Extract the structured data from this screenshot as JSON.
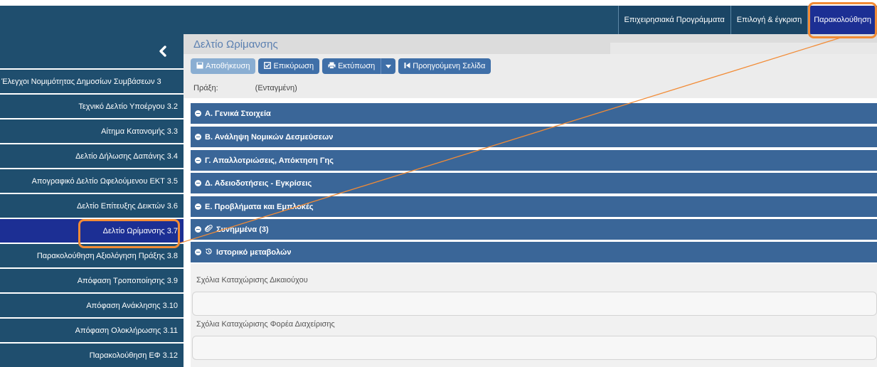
{
  "topnav": {
    "items": [
      {
        "label": "Επιχειρησιακά Προγράμματα"
      },
      {
        "label": "Επιλογή & έγκριση"
      },
      {
        "label": "Παρακολούθηση"
      }
    ]
  },
  "sidebar": {
    "collapse_icon": "chevron-left-icon",
    "items": [
      {
        "label": "Έλεγχοι Νομιμότητας Δημοσίων Συμβάσεων 3"
      },
      {
        "label": "Τεχνικό Δελτίο Υποέργου 3.2"
      },
      {
        "label": "Αίτημα Κατανομής 3.3"
      },
      {
        "label": "Δελτίο Δήλωσης Δαπάνης 3.4"
      },
      {
        "label": "Απογραφικό Δελτίο Ωφελούμενου ΕΚΤ 3.5"
      },
      {
        "label": "Δελτίο Επίτευξης Δεικτών 3.6"
      },
      {
        "label": "Δελτίο Ωρίμανσης 3.7"
      },
      {
        "label": "Παρακολούθηση Αξιολόγηση Πράξης 3.8"
      },
      {
        "label": "Απόφαση Τροποποίησης 3.9"
      },
      {
        "label": "Απόφαση Ανάκλησης 3.10"
      },
      {
        "label": "Απόφαση Ολοκλήρωσης 3.11"
      },
      {
        "label": "Παρακολούθηση ΕΦ 3.12"
      }
    ]
  },
  "main": {
    "title": "Δελτίο Ωρίμανσης",
    "toolbar": {
      "save_label": "Αποθήκευση",
      "validate_label": "Επικύρωση",
      "print_label": "Εκτύπωση",
      "prev_page_label": "Προηγούμενη Σελίδα"
    },
    "info": {
      "label": "Πράξη:",
      "value": "(Ενταγμένη)"
    },
    "sections": [
      {
        "label": "Α. Γενικά Στοιχεία"
      },
      {
        "label": "Β. Ανάληψη Νομικών Δεσμεύσεων"
      },
      {
        "label": "Γ. Απαλλοτριώσεις, Απόκτηση Γης"
      },
      {
        "label": "Δ. Αδειοδοτήσεις - Εγκρίσεις"
      },
      {
        "label": "Ε. Προβλήματα και Εμπλοκές"
      },
      {
        "label": "Συνημμένα (3)"
      },
      {
        "label": "Ιστορικό μεταβολών"
      }
    ],
    "comments": {
      "beneficiary_label": "Σχόλια Καταχώρισης Δικαιούχου",
      "managing_label": "Σχόλια Καταχώρισης Φορέα Διαχείρισης"
    }
  },
  "colors": {
    "nav_bg": "#1f4e6e",
    "active_bg": "#1c2f94",
    "section_bg": "#3a6698",
    "button_bg": "#3f6fa8",
    "highlight": "#f28b35"
  }
}
